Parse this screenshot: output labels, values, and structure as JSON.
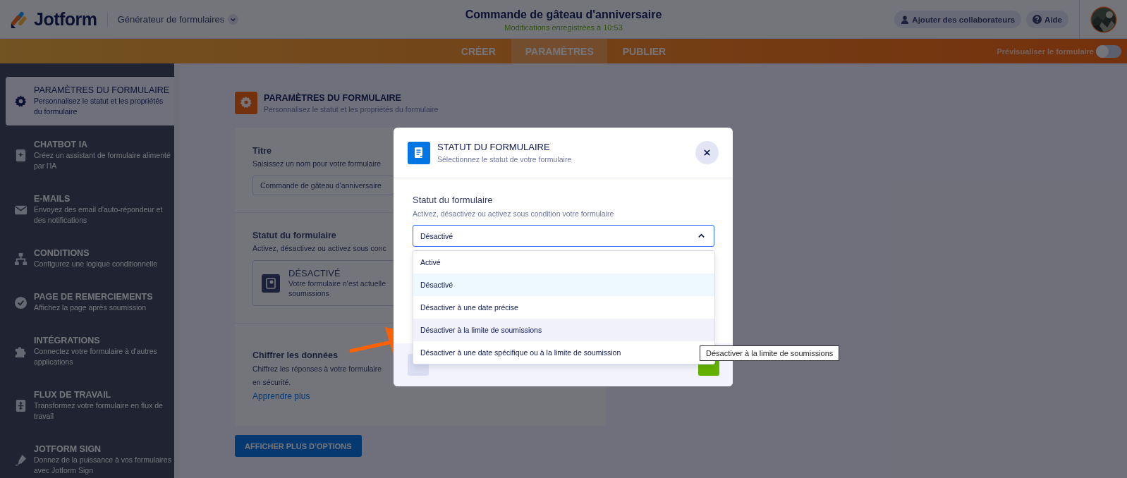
{
  "header": {
    "brand": "Jotform",
    "builder_menu": "Générateur de formulaires",
    "form_title": "Commande de gâteau d'anniversaire",
    "save_status": "Modifications enregistrées à 10:53",
    "buttons": [
      {
        "label": "Ajouter des collaborateurs",
        "kind": "collaborators"
      },
      {
        "label": "Aide",
        "kind": "help"
      }
    ]
  },
  "tabs": [
    {
      "label": "CRÉER",
      "selected": false
    },
    {
      "label": "PARAMÈTRES",
      "selected": true
    },
    {
      "label": "PUBLIER",
      "selected": false
    }
  ],
  "preview_toggle": {
    "label": "Prévisualiser le formulaire",
    "on": false
  },
  "sidebar": {
    "items": [
      {
        "title": "PARAMÈTRES DU FORMULAIRE",
        "description": "Personnalisez le statut et les propriétés du formulaire",
        "kind": "gear",
        "selected": true
      },
      {
        "title": "CHATBOT IA",
        "description": "Créez un assistant de formulaire alimenté par l'IA",
        "kind": "sparkle",
        "selected": false
      },
      {
        "title": "E-MAILS",
        "description": "Envoyez des email d'auto-répondeur et des notifications",
        "kind": "mail",
        "selected": false
      },
      {
        "title": "CONDITIONS",
        "description": "Configurez une logique conditionnelle",
        "kind": "hierarchy",
        "selected": false
      },
      {
        "title": "PAGE DE REMERCIEMENTS",
        "description": "Affichez la page après soumission",
        "kind": "check",
        "selected": false
      },
      {
        "title": "INTÉGRATIONS",
        "description": "Connectez votre formulaire à d'autres applications",
        "kind": "puzzle",
        "selected": false
      },
      {
        "title": "FLUX DE TRAVAIL",
        "description": "Transformez votre formulaire en flux de travail",
        "kind": "flow",
        "selected": false
      },
      {
        "title": "JOTFORM SIGN",
        "description": "Donnez de la puissance à vos formulaires avec Jotform Sign",
        "kind": "pen",
        "selected": false
      }
    ]
  },
  "page_header": {
    "title": "PARAMÈTRES DU FORMULAIRE",
    "subtitle": "Personnalisez le statut et les propriétés du formulaire"
  },
  "title_section": {
    "label": "Titre",
    "hint": "Saisissez un nom pour votre formulaire",
    "value": "Commande de gâteau d'anniversaire"
  },
  "status_section": {
    "label": "Statut du formulaire",
    "hint": "Activez, désactivez ou activez sous conc",
    "status_title": "DÉSACTIVÉ",
    "status_lines": [
      "Votre formulaire n'est actuelle",
      "soumissions"
    ]
  },
  "encrypt_section": {
    "label": "Chiffrer les données",
    "lines": [
      "Chiffrez les réponses à votre formulaire",
      "en sécurité."
    ],
    "link": "Apprendre plus"
  },
  "more_options_button": "AFFICHER PLUS D’OPTIONS",
  "modal": {
    "title": "STATUT DU FORMULAIRE",
    "subtitle": "Sélectionnez le statut de votre formulaire",
    "field_label": "Statut du formulaire",
    "field_hint": "Activez, désactivez ou activez sous condition votre formulaire",
    "value": "Désactivé",
    "expanded": true,
    "options": [
      {
        "label": "Activé",
        "selected": false,
        "hovered": false
      },
      {
        "label": "Désactivé",
        "selected": true,
        "hovered": false
      },
      {
        "label": "Désactiver à une date précise",
        "selected": false,
        "hovered": false
      },
      {
        "label": "Désactiver à la limite de soumissions",
        "selected": false,
        "hovered": true
      },
      {
        "label": "Désactiver à une date spécifique ou à la limite de soumission",
        "selected": false,
        "hovered": false
      }
    ],
    "footer_buttons": [
      {
        "kind": "cancel"
      },
      {
        "kind": "save"
      }
    ]
  },
  "tooltip": "Désactiver à la limite de soumissions"
}
